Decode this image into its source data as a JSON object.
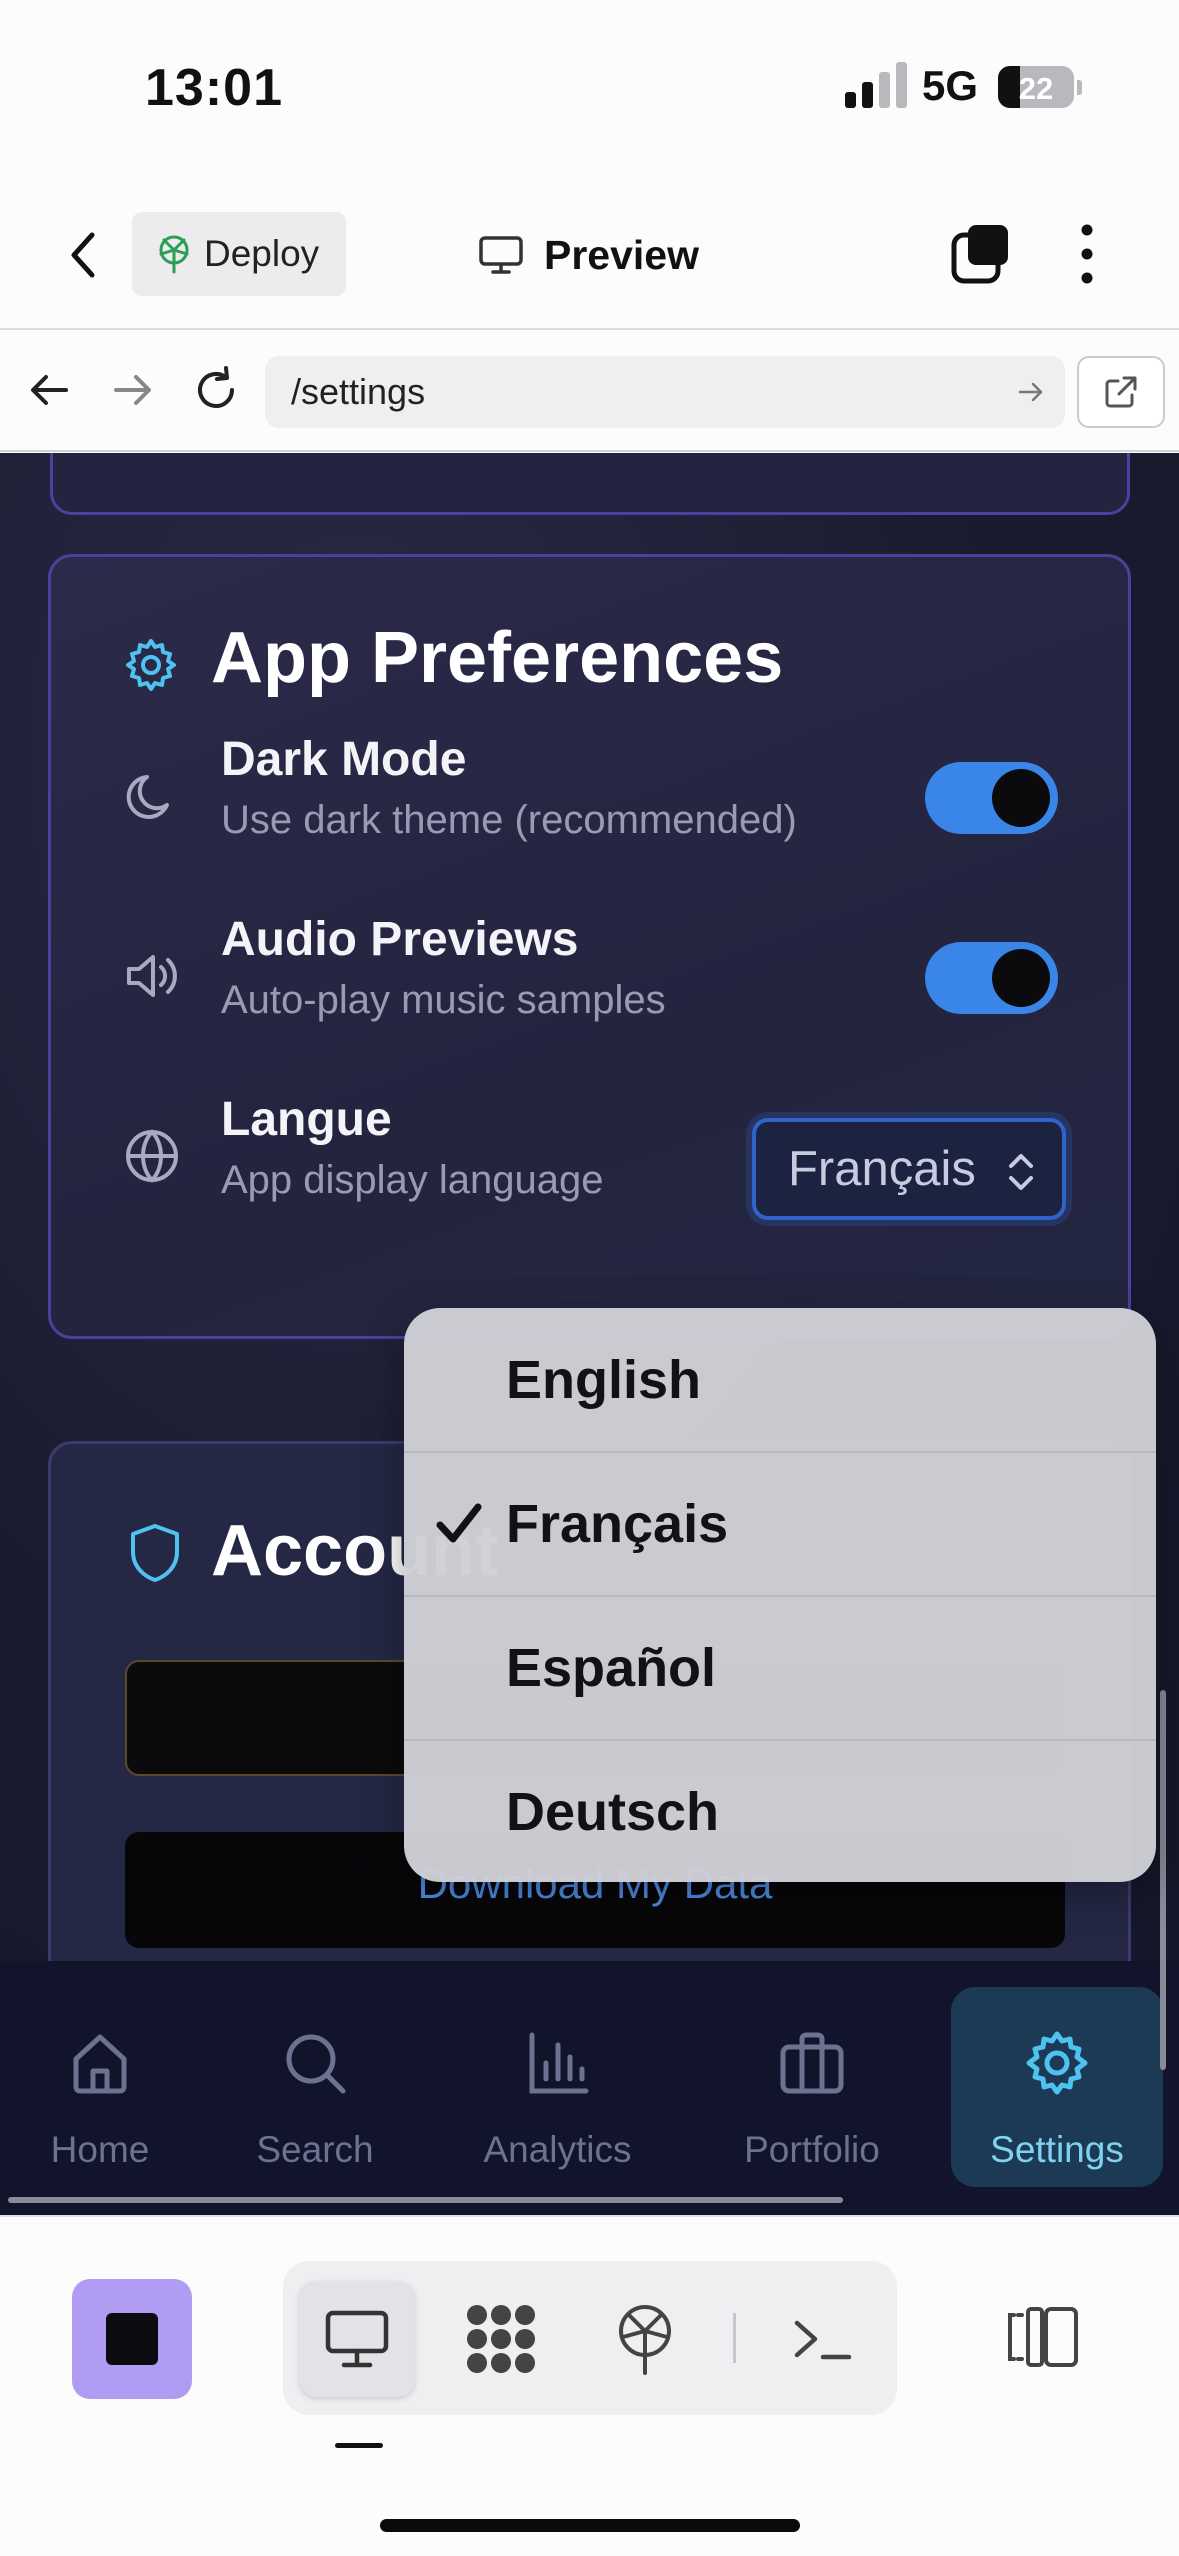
{
  "status_bar": {
    "time": "13:01",
    "network": "5G",
    "battery": "22"
  },
  "editor_header": {
    "deploy_label": "Deploy",
    "preview_label": "Preview"
  },
  "browser": {
    "url": "/settings"
  },
  "preferences": {
    "title": "App Preferences",
    "rows": [
      {
        "label": "Dark Mode",
        "description": "Use dark theme (recommended)",
        "enabled": true
      },
      {
        "label": "Audio Previews",
        "description": "Auto-play music samples",
        "enabled": true
      },
      {
        "label": "Langue",
        "description": "App display language",
        "selected": "Français"
      }
    ]
  },
  "account": {
    "title": "Account",
    "download_label": "Download My Data"
  },
  "language_menu": {
    "options": [
      "English",
      "Français",
      "Español",
      "Deutsch"
    ],
    "selected": "Français"
  },
  "tabs": [
    {
      "label": "Home",
      "icon": "home-icon"
    },
    {
      "label": "Search",
      "icon": "search-icon"
    },
    {
      "label": "Analytics",
      "icon": "bar-chart-icon"
    },
    {
      "label": "Portfolio",
      "icon": "briefcase-icon"
    },
    {
      "label": "Settings",
      "icon": "gear-icon",
      "active": true
    }
  ],
  "colors": {
    "accent": "#3a86e8",
    "card_border": "#4e3f9e",
    "active_tab": "#7fd3f0",
    "stop_button": "#b09cf2"
  }
}
